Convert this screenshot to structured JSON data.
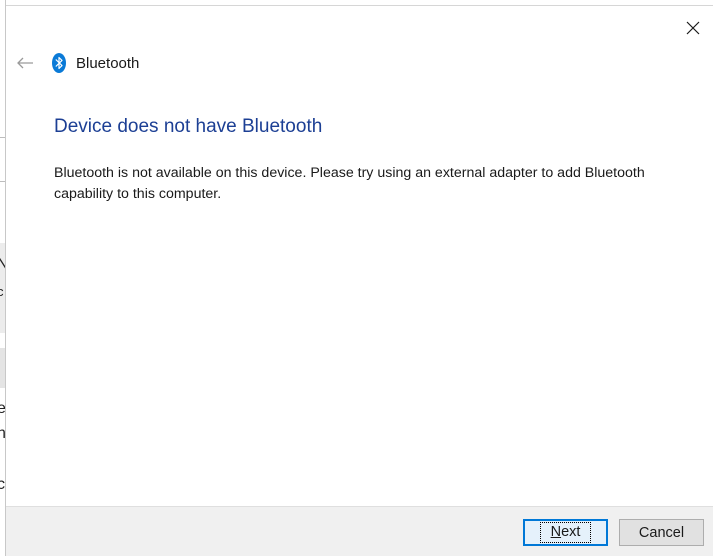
{
  "background_window": {
    "glyphs": [
      "N",
      "c",
      "e",
      "n",
      "c"
    ]
  },
  "dialog": {
    "title": "Bluetooth",
    "heading": "Device does not have Bluetooth",
    "message": "Bluetooth is not available on this device. Please try using an external adapter to add Bluetooth capability to this computer.",
    "buttons": {
      "next_access_key": "N",
      "next_rest": "ext",
      "cancel": "Cancel"
    }
  },
  "colors": {
    "heading": "#1c3f94",
    "bluetooth_icon": "#0a7ad7",
    "focus_border": "#0078d7"
  },
  "icons": {
    "close": "close-icon",
    "back": "back-arrow-icon",
    "bluetooth": "bluetooth-icon"
  }
}
